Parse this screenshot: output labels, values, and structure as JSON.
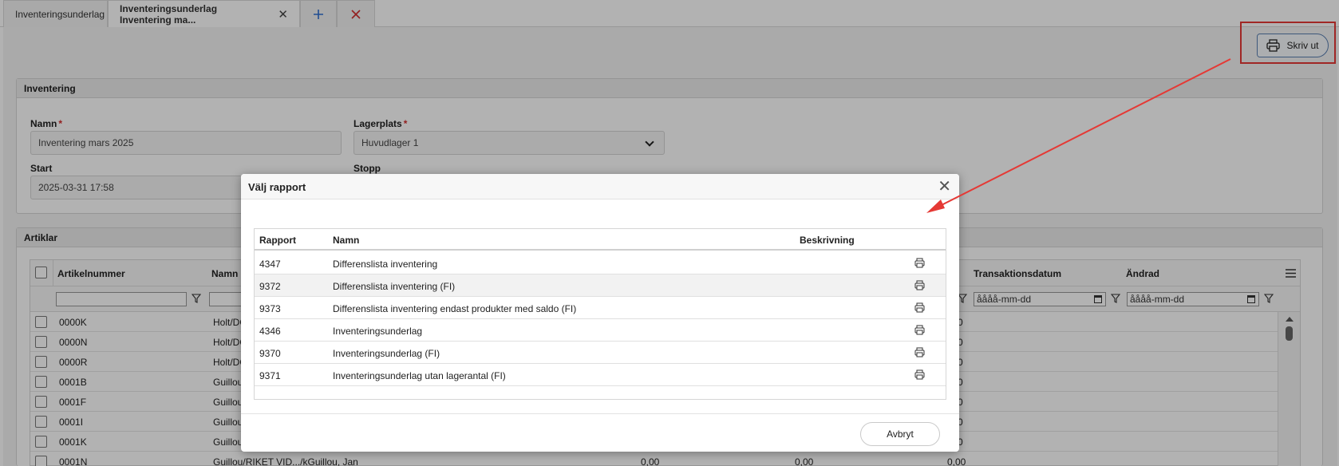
{
  "tabs": [
    {
      "label": "Inventeringsunderlag"
    },
    {
      "label": "Inventeringsunderlag Inventering ma..."
    }
  ],
  "toolbar": {
    "print_label": "Skriv ut"
  },
  "inventering": {
    "heading": "Inventering",
    "name_label": "Namn",
    "name_value": "Inventering mars 2025",
    "lagerplats_label": "Lagerplats",
    "lagerplats_value": "Huvudlager 1",
    "start_label": "Start",
    "start_value": "2025-03-31 17:58",
    "stopp_label": "Stopp"
  },
  "artiklar": {
    "heading": "Artiklar",
    "columns": {
      "artikelnummer": "Artikelnummer",
      "namn": "Namn",
      "transaktionsdatum": "Transaktionsdatum",
      "andrad": "Ändrad"
    },
    "date_placeholder": "åååå-mm-dd",
    "rows": [
      {
        "nr": "0000K",
        "namn": "Holt/DÖ",
        "v3": ".00"
      },
      {
        "nr": "0000N",
        "namn": "Holt/DÖ",
        "v3": ".00"
      },
      {
        "nr": "0000R",
        "namn": "Holt/DÖ",
        "v3": ".00"
      },
      {
        "nr": "0001B",
        "namn": "Guillou/",
        "v3": ".00"
      },
      {
        "nr": "0001F",
        "namn": "Guillou/",
        "v3": ".00"
      },
      {
        "nr": "0001I",
        "namn": "Guillou/",
        "v3": ".00"
      },
      {
        "nr": "0001K",
        "namn": "Guillou/",
        "v3": ".00"
      },
      {
        "nr": "0001N",
        "namn": "Guillou/RIKET VID.../kGuillou, Jan",
        "v1": "0,00",
        "v2": "0,00",
        "v3": "0,00"
      }
    ]
  },
  "modal": {
    "title": "Välj rapport",
    "columns": {
      "rapport": "Rapport",
      "namn": "Namn",
      "beskrivning": "Beskrivning"
    },
    "reports": [
      {
        "id": "4347",
        "name": "Differenslista inventering"
      },
      {
        "id": "9372",
        "name": "Differenslista inventering (FI)"
      },
      {
        "id": "9373",
        "name": "Differenslista inventering endast produkter med saldo (FI)"
      },
      {
        "id": "4346",
        "name": "Inventeringsunderlag"
      },
      {
        "id": "9370",
        "name": "Inventeringsunderlag (FI)"
      },
      {
        "id": "9371",
        "name": "Inventeringsunderlag utan lagerantal (FI)"
      }
    ],
    "cancel_label": "Avbryt"
  },
  "colors": {
    "annotation": "#e53935",
    "tab_add": "#2f6fd1",
    "tab_close": "#d32f2f",
    "required": "#d32f2f"
  },
  "icons": {
    "print": "printer-icon",
    "close": "close-icon",
    "add": "plus-icon",
    "filter": "funnel-icon",
    "menu": "hamburger-icon"
  }
}
